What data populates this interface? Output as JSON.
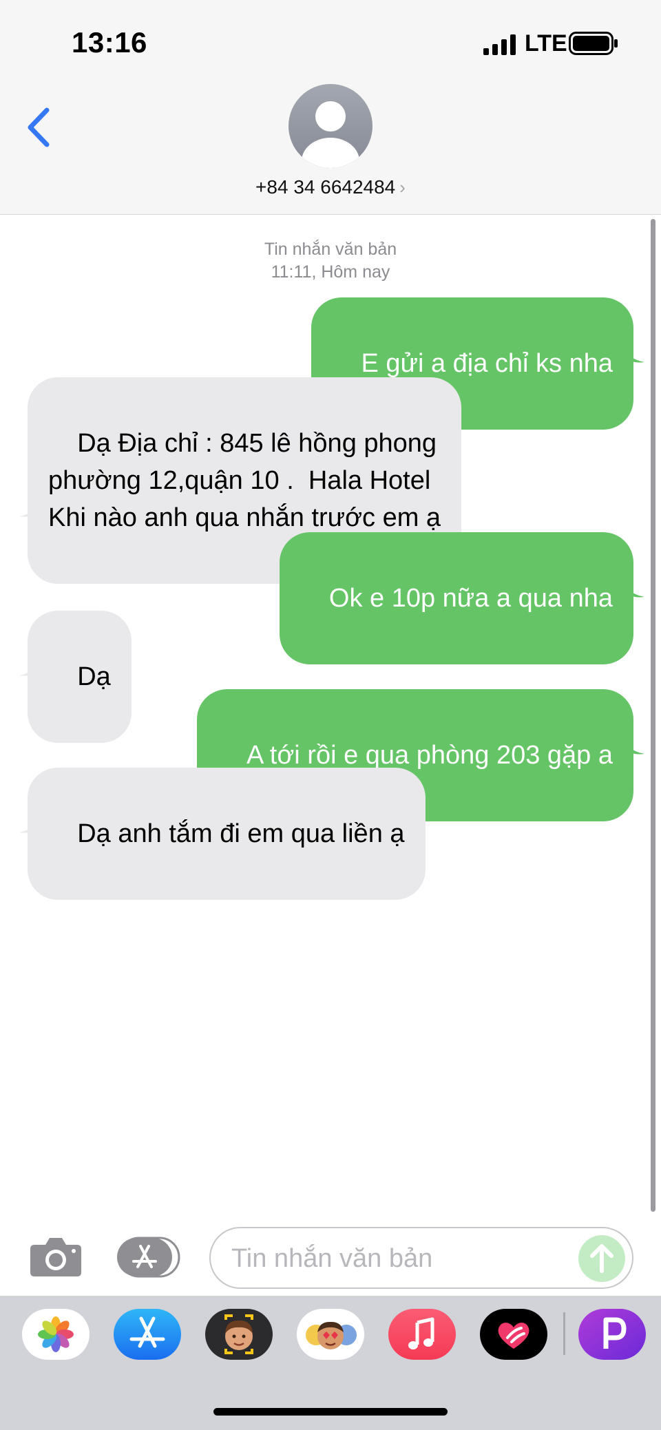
{
  "status_bar": {
    "time": "13:16",
    "network": "LTE"
  },
  "header": {
    "contact": "+84 34 6642484",
    "contact_chevron": "›"
  },
  "thread": {
    "timestamp_type": "Tin nhắn văn bản",
    "timestamp_time": "11:11, Hôm nay",
    "messages": [
      {
        "direction": "sent",
        "text": "E gửi a địa chỉ ks nha"
      },
      {
        "direction": "received",
        "text": "Dạ Địa chỉ : 845 lê hồng phong\nphường 12,quận 10 .  Hala Hotel\nKhi nào anh qua nhắn trước em ạ"
      },
      {
        "direction": "sent",
        "text": "Ok e 10p nữa a qua nha"
      },
      {
        "direction": "received",
        "text": "Dạ"
      },
      {
        "direction": "sent",
        "text": "A tới rồi e qua phòng 203 gặp a"
      },
      {
        "direction": "received",
        "text": "Dạ anh tắm đi em qua liền ạ"
      }
    ]
  },
  "input_bar": {
    "placeholder": "Tin nhắn văn bản",
    "camera_icon": "camera-icon",
    "apps_icon": "app-store-icon",
    "send_icon": "send-arrow-icon"
  },
  "app_drawer": {
    "apps": [
      "photos-icon",
      "app-store-icon",
      "memoji-stickers-icon",
      "animoji-icon",
      "music-icon",
      "digital-touch-icon",
      "purple-p-app-icon"
    ]
  },
  "colors": {
    "sent_bubble": "#65c466",
    "received_bubble": "#e9e9eb",
    "accent_blue": "#3478f6",
    "header_bg": "#f6f6f7",
    "drawer_bg": "#d2d3d9"
  }
}
